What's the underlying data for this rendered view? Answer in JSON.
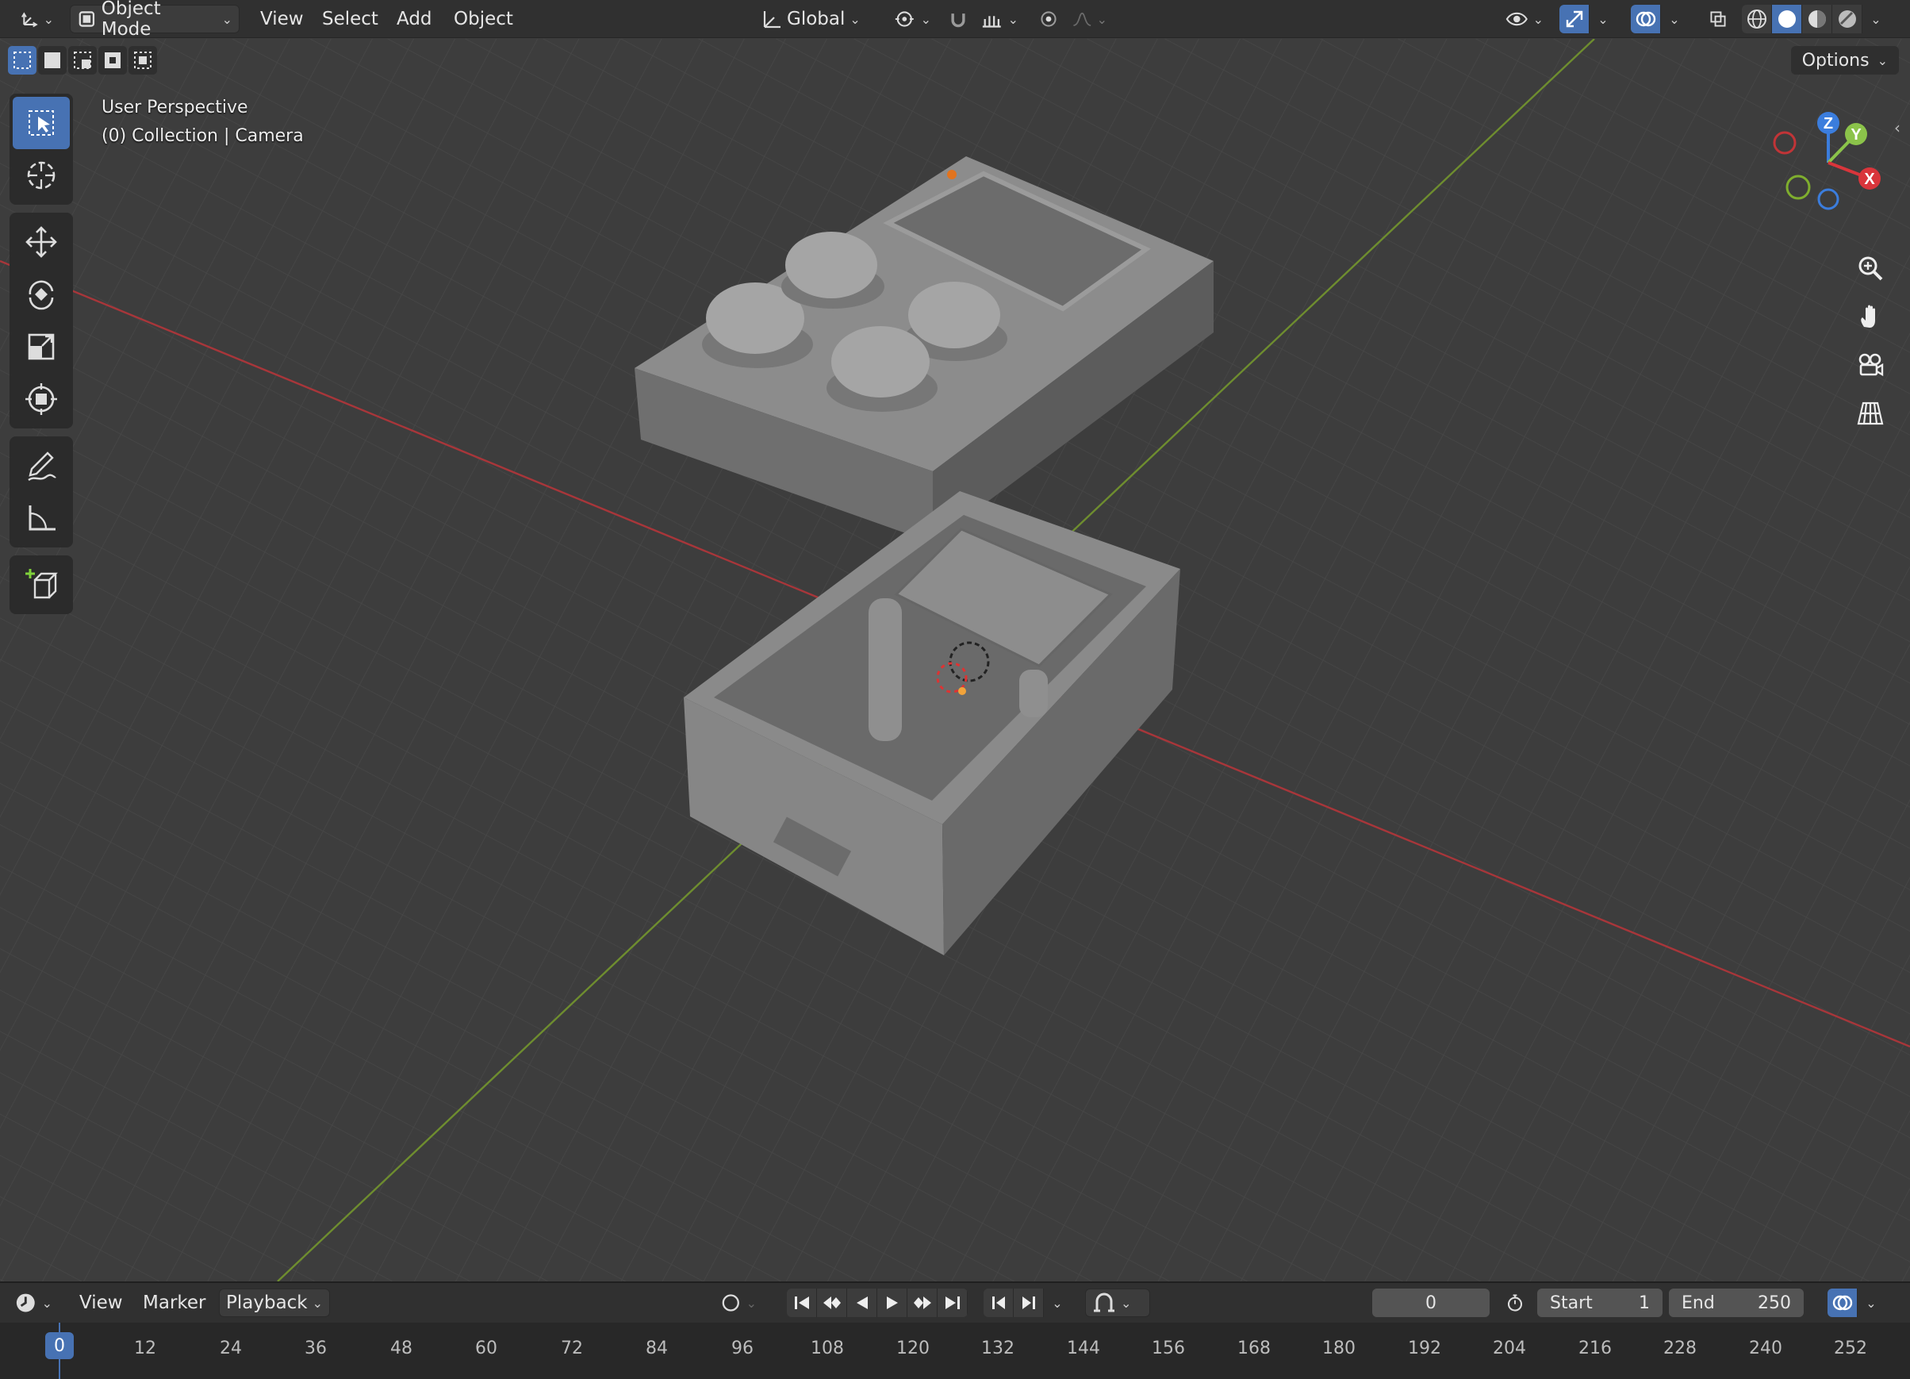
{
  "header": {
    "mode": "Object Mode",
    "menus": [
      "View",
      "Select",
      "Add",
      "Object"
    ],
    "orientation": "Global"
  },
  "viewport": {
    "view_name": "User Perspective",
    "collection": "(0) Collection | Camera",
    "options_label": "Options",
    "gizmo_axes": [
      "Z",
      "Y",
      "X"
    ]
  },
  "timeline": {
    "menus": [
      "View",
      "Marker",
      "Playback"
    ],
    "current_frame": "0",
    "start_label": "Start",
    "start_value": "1",
    "end_label": "End",
    "end_value": "250",
    "ruler": [
      "0",
      "12",
      "24",
      "36",
      "48",
      "60",
      "72",
      "84",
      "96",
      "108",
      "120",
      "132",
      "144",
      "156",
      "168",
      "180",
      "192",
      "204",
      "216",
      "228",
      "240",
      "252"
    ]
  },
  "colors": {
    "accent": "#4772b3",
    "x_axis": "#d9353b",
    "y_axis": "#8bc34a",
    "z_axis": "#3b7ddd",
    "grid": "#474747"
  }
}
